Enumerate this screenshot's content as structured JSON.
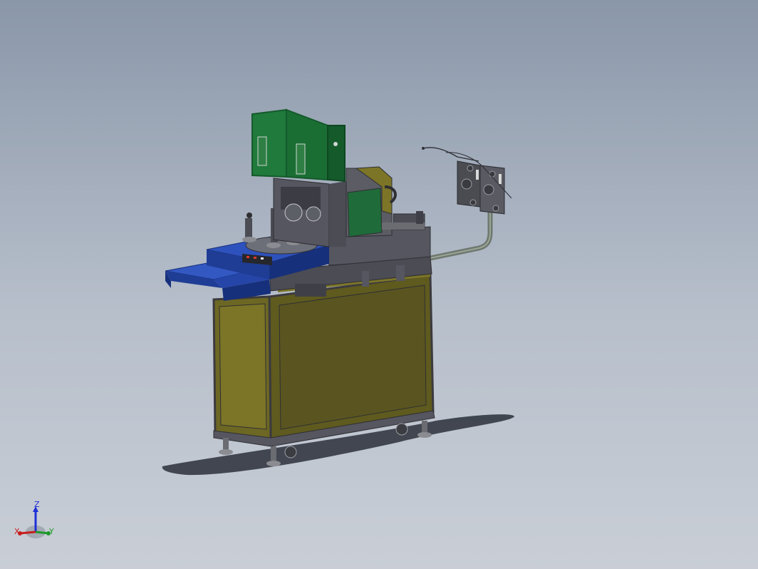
{
  "viewport": {
    "background_top": "#8a97a9",
    "background_bottom": "#c9ced6"
  },
  "model": {
    "colors": {
      "frame_yellow": "#5f5a1e",
      "frame_yellow_light": "#7c7527",
      "frame_gray": "#55565f",
      "table_blue": "#2546a8",
      "table_blue_dark": "#17307b",
      "guard_green": "#1f7a3b",
      "guard_green_dark": "#145a2b",
      "pipe": "#7c857a",
      "shadow": "#2a2f3a"
    }
  },
  "triad": {
    "z_label": "Z",
    "x_label": "X",
    "y_label": "Y",
    "z_color": "#1e2fd8",
    "x_color": "#c81e1e",
    "y_color": "#1f9a2a"
  }
}
